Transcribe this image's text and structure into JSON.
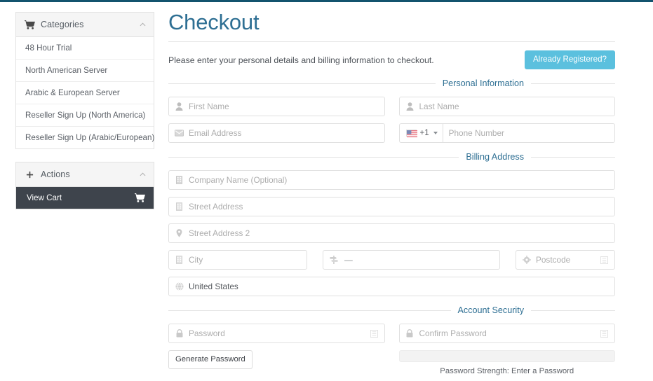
{
  "sidebar": {
    "categories_panel": {
      "icon": "cart-icon",
      "title": "Categories",
      "collapse_icon": "chevron-up-icon",
      "items": [
        "48 Hour Trial",
        "North American Server",
        "Arabic & European Server",
        "Reseller Sign Up (North America)",
        "Reseller Sign Up (Arabic/European)"
      ]
    },
    "actions_panel": {
      "icon": "plus-icon",
      "title": "Actions",
      "collapse_icon": "chevron-up-icon",
      "view_cart_label": "View Cart",
      "view_cart_icon": "cart-icon"
    }
  },
  "main": {
    "title": "Checkout",
    "intro": "Please enter your personal details and billing information to checkout.",
    "already_registered_label": "Already Registered?",
    "sections": {
      "personal": "Personal Information",
      "billing": "Billing Address",
      "security": "Account Security"
    },
    "fields": {
      "first_name": {
        "placeholder": "First Name",
        "icon": "user-icon"
      },
      "last_name": {
        "placeholder": "Last Name",
        "icon": "user-icon"
      },
      "email": {
        "placeholder": "Email Address",
        "icon": "envelope-icon"
      },
      "phone": {
        "placeholder": "Phone Number",
        "country_code": "+1",
        "flag": "us-flag-icon",
        "caret": "chevron-down-icon"
      },
      "company": {
        "placeholder": "Company Name (Optional)",
        "icon": "building-icon"
      },
      "street1": {
        "placeholder": "Street Address",
        "icon": "building-icon"
      },
      "street2": {
        "placeholder": "Street Address 2",
        "icon": "map-pin-icon"
      },
      "city": {
        "placeholder": "City",
        "icon": "building-icon"
      },
      "state": {
        "value": "—",
        "icon": "signpost-icon"
      },
      "postcode": {
        "placeholder": "Postcode",
        "icon": "gear-icon",
        "right_icon": "box-glyph-icon"
      },
      "country": {
        "value": "United States",
        "icon": "globe-icon"
      },
      "password": {
        "placeholder": "Password",
        "icon": "lock-icon",
        "right_icon": "box-glyph-icon"
      },
      "confirm_password": {
        "placeholder": "Confirm Password",
        "icon": "lock-icon",
        "right_icon": "box-glyph-icon"
      }
    },
    "generate_password_label": "Generate Password",
    "password_strength_text": "Password Strength: Enter a Password"
  },
  "colors": {
    "topbar": "#13536e",
    "heading": "#2e6f93",
    "accent_button": "#5bc0de",
    "dark_button": "#3e444c"
  }
}
